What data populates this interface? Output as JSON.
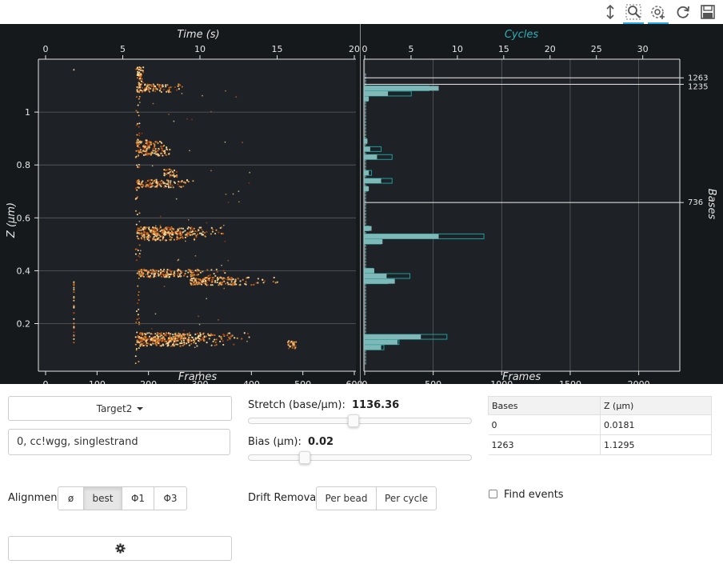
{
  "toolbar": {
    "tools": [
      {
        "name": "y-wheel-zoom-icon",
        "active": false
      },
      {
        "name": "box-zoom-icon",
        "active": true
      },
      {
        "name": "wheel-zoom-icon",
        "active": true
      },
      {
        "name": "reset-icon",
        "active": false
      },
      {
        "name": "save-icon",
        "active": false
      }
    ]
  },
  "colors": {
    "plot_bg": "#1e2126",
    "frame_bg": "#16191c",
    "grid": "#5a5e5f",
    "axis_text": "#e5e5e5",
    "cycles_title": "#2ab1b7",
    "hist_fill": "#7fb8b6",
    "hist_outline": "#1c9e9e",
    "event_colors": [
      "#f2d08a",
      "#e9a24a",
      "#d46a16",
      "#b5420c",
      "#ffe2a8"
    ]
  },
  "chart_data": [
    {
      "type": "scatter",
      "title": "",
      "xlabel_top": "Time (s)",
      "xlabel_bottom": "Frames",
      "ylabel": "Z (μm)",
      "xlim_time": [
        0,
        20
      ],
      "xticks_time": [
        "0",
        "5",
        "10",
        "15",
        "20"
      ],
      "xlim_frames": [
        0,
        600
      ],
      "xticks_frames": [
        "0",
        "100",
        "200",
        "300",
        "400",
        "500",
        "600"
      ],
      "ylim": [
        0.02,
        1.2
      ],
      "yticks": [
        "0.2",
        "0.4",
        "0.6",
        "0.8",
        "1"
      ],
      "grid": "horizontal",
      "clusters": [
        {
          "frame_start": 178,
          "frame_end": 280,
          "z": 1.09
        },
        {
          "frame_start": 178,
          "frame_end": 240,
          "z": 0.88
        },
        {
          "frame_start": 178,
          "frame_end": 260,
          "z": 0.85
        },
        {
          "frame_start": 178,
          "frame_end": 300,
          "z": 0.73
        },
        {
          "frame_start": 230,
          "frame_end": 265,
          "z": 0.77
        },
        {
          "frame_start": 178,
          "frame_end": 370,
          "z": 0.55
        },
        {
          "frame_start": 178,
          "frame_end": 320,
          "z": 0.53
        },
        {
          "frame_start": 178,
          "frame_end": 370,
          "z": 0.39
        },
        {
          "frame_start": 280,
          "frame_end": 460,
          "z": 0.36
        },
        {
          "frame_start": 178,
          "frame_end": 420,
          "z": 0.15
        },
        {
          "frame_start": 178,
          "frame_end": 380,
          "z": 0.13
        },
        {
          "frame_start": 470,
          "frame_end": 500,
          "z": 0.12
        }
      ],
      "early_column": {
        "frame": 55,
        "z_min": 0.12,
        "z_max": 0.36
      },
      "scatter_column": {
        "frame": 175,
        "z_min": 0.05,
        "z_max": 1.17
      }
    },
    {
      "type": "bar",
      "orientation": "horizontal",
      "xlabel_top": "Cycles",
      "xlabel_bottom": "Frames",
      "ylabel_right": "Bases",
      "xlim_cycles": [
        0,
        34
      ],
      "xticks_cycles": [
        "0",
        "5",
        "10",
        "15",
        "20",
        "25",
        "30"
      ],
      "xlim_frames": [
        0,
        2300
      ],
      "xticks_frames": [
        "0",
        "500",
        "1000",
        "1500",
        "2000"
      ],
      "ylim": [
        0.02,
        1.2
      ],
      "bins": [
        {
          "z": 1.09,
          "count": 540,
          "outline": 470
        },
        {
          "z": 1.07,
          "count": 170,
          "outline": 340
        },
        {
          "z": 1.05,
          "count": 30,
          "outline": 20
        },
        {
          "z": 0.89,
          "count": 20,
          "outline": 15
        },
        {
          "z": 0.86,
          "count": 40,
          "outline": 120
        },
        {
          "z": 0.83,
          "count": 90,
          "outline": 200
        },
        {
          "z": 0.77,
          "count": 30,
          "outline": 50
        },
        {
          "z": 0.74,
          "count": 120,
          "outline": 200
        },
        {
          "z": 0.71,
          "count": 30,
          "outline": 20
        },
        {
          "z": 0.56,
          "count": 50,
          "outline": 30
        },
        {
          "z": 0.53,
          "count": 540,
          "outline": 870
        },
        {
          "z": 0.51,
          "count": 130,
          "outline": 120
        },
        {
          "z": 0.4,
          "count": 70,
          "outline": 60
        },
        {
          "z": 0.38,
          "count": 160,
          "outline": 330
        },
        {
          "z": 0.36,
          "count": 220,
          "outline": 170
        },
        {
          "z": 0.15,
          "count": 410,
          "outline": 600
        },
        {
          "z": 0.13,
          "count": 240,
          "outline": 250
        },
        {
          "z": 0.11,
          "count": 120,
          "outline": 140
        }
      ],
      "baseline_count": 12,
      "markers": [
        {
          "label": "1263",
          "z": 1.1295
        },
        {
          "label": "1235",
          "z": 1.105
        },
        {
          "label": "736",
          "z": 0.658
        }
      ]
    }
  ],
  "sequence_dropdown": {
    "label": "Target2"
  },
  "oligos_input": {
    "value": "0, cc!wgg, singlestrand",
    "placeholder": ""
  },
  "stretch": {
    "label": "Stretch (base/μm):",
    "value": "1136.36",
    "fraction": 0.47
  },
  "bias": {
    "label": "Bias (μm):",
    "value": "0.02",
    "fraction": 0.24
  },
  "peaks_table": {
    "columns": [
      "Bases",
      "Z (μm)"
    ],
    "rows": [
      [
        "0",
        "0.0181"
      ],
      [
        "1263",
        "1.1295"
      ]
    ]
  },
  "alignment": {
    "label": "Alignment",
    "options": [
      "ø",
      "best",
      "Φ1",
      "Φ3"
    ],
    "selected": "best"
  },
  "drift": {
    "label": "Drift Removal",
    "options": [
      "Per bead",
      "Per cycle"
    ]
  },
  "find_events": {
    "label": "Find events",
    "checked": false
  },
  "settings_button": {
    "icon": "gear-icon"
  }
}
